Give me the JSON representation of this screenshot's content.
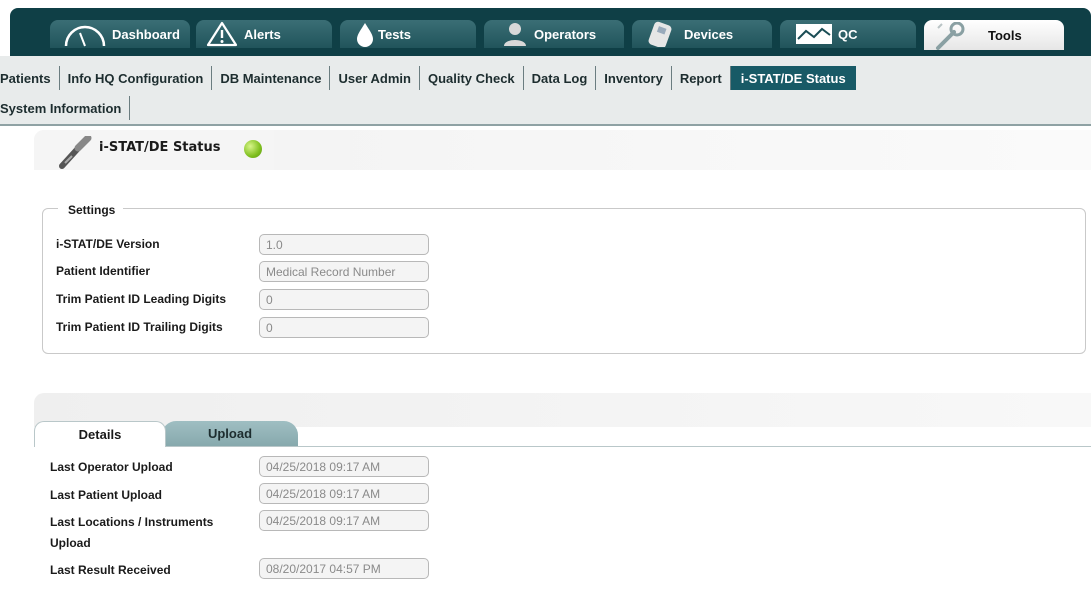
{
  "top_tabs": [
    {
      "label": "Dashboard",
      "icon": "gauge-icon"
    },
    {
      "label": "Alerts",
      "icon": "warning-icon"
    },
    {
      "label": "Tests",
      "icon": "droplet-icon"
    },
    {
      "label": "Operators",
      "icon": "operator-icon"
    },
    {
      "label": "Devices",
      "icon": "device-icon"
    },
    {
      "label": "QC",
      "icon": "chart-icon"
    },
    {
      "label": "Tools",
      "icon": "wrench-icon",
      "active": true
    }
  ],
  "subnav": {
    "row1": [
      "Patients",
      "Info HQ Configuration",
      "DB Maintenance",
      "User Admin",
      "Quality Check",
      "Data Log",
      "Inventory",
      "Report",
      "i-STAT/DE Status"
    ],
    "row2": [
      "System Information"
    ],
    "active": "i-STAT/DE Status"
  },
  "status": {
    "title": "i-STAT/DE Status",
    "indicator_color": "#7fbf1e"
  },
  "settings": {
    "legend": "Settings",
    "fields": [
      {
        "label": "i-STAT/DE Version",
        "value": "1.0"
      },
      {
        "label": "Patient Identifier",
        "value": "Medical Record Number"
      },
      {
        "label": "Trim Patient ID Leading Digits",
        "value": "0"
      },
      {
        "label": "Trim Patient ID Trailing Digits",
        "value": "0"
      }
    ]
  },
  "detail_tabs": {
    "details": "Details",
    "upload": "Upload"
  },
  "details": {
    "fields": [
      {
        "label": "Last Operator Upload",
        "value": "04/25/2018 09:17 AM"
      },
      {
        "label": "Last Patient Upload",
        "value": "04/25/2018 09:17 AM"
      },
      {
        "label": "Last Locations / Instruments",
        "label2": "Upload",
        "value": "04/25/2018 09:17 AM"
      },
      {
        "label": "Last Result Received",
        "value": "08/20/2017 04:57 PM"
      }
    ]
  },
  "colors": {
    "topbar": "#0f3f46",
    "active_subnav": "#185a66",
    "status_ok": "#7fbf1e"
  }
}
